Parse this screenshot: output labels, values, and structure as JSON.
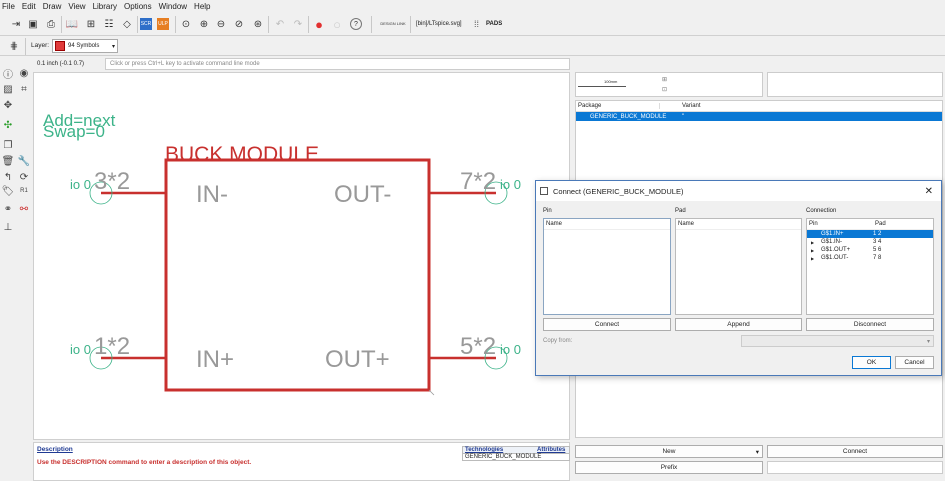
{
  "menu": [
    "File",
    "Edit",
    "Draw",
    "View",
    "Library",
    "Options",
    "Window",
    "Help"
  ],
  "toolbar": {
    "path_label": "[bin]/LTspice.svg]",
    "pads_label": "PADS",
    "design_link": "DESIGN LINK",
    "scr_label": "SCR",
    "ulp_label": "ULP"
  },
  "layer_bar": {
    "label": "Layer:",
    "selected": "94 Symbols"
  },
  "coord": {
    "readout": "0.1 inch (-0.1 0.7)",
    "command_placeholder": "Click or press Ctrl+L key to activate command line mode"
  },
  "schematic": {
    "add_text": "Add=next",
    "swap_text": "Swap=0",
    "title": "BUCK MODULE",
    "pins": [
      {
        "name": "IN-",
        "pad": "3*2",
        "io": "io 0"
      },
      {
        "name": "OUT-",
        "pad": "7*2",
        "io": "io 0"
      },
      {
        "name": "IN+",
        "pad": "1*2",
        "io": "io 0"
      },
      {
        "name": "OUT+",
        "pad": "5*2",
        "io": "io 0"
      }
    ]
  },
  "description": {
    "heading": "Description",
    "text": "Use the DESCRIPTION command to enter a description of this object.",
    "tech_headers": [
      "Technologies",
      "Attributes"
    ],
    "tech_row": "GENERIC_BUCK_MODULE"
  },
  "right_panel": {
    "preview_label": "100mm",
    "columns": [
      "Package",
      "Variant"
    ],
    "package_row": "GENERIC_BUCK_MODULE",
    "variant_row": "''",
    "new_label": "New",
    "connect_label": "Connect",
    "prefix_label": "Prefix"
  },
  "dialog": {
    "title": "Connect  (GENERIC_BUCK_MODULE)",
    "pin_section": "Pin",
    "pad_section": "Pad",
    "connection_section": "Connection",
    "pin_col": "Name",
    "pad_col": "Name",
    "conn_cols": [
      "Pin",
      "Pad"
    ],
    "connections": [
      {
        "pin": "G$1.IN+",
        "pad": "1 2",
        "selected": true
      },
      {
        "pin": "G$1.IN-",
        "pad": "3 4",
        "selected": false
      },
      {
        "pin": "G$1.OUT+",
        "pad": "5 6",
        "selected": false
      },
      {
        "pin": "G$1.OUT-",
        "pad": "7 8",
        "selected": false
      }
    ],
    "connect_btn": "Connect",
    "append_btn": "Append",
    "disconnect_btn": "Disconnect",
    "copy_from_label": "Copy from:",
    "ok_btn": "OK",
    "cancel_btn": "Cancel"
  },
  "colors": {
    "symbol": "#c8302e",
    "pin_text": "#999999",
    "name_text": "#3cb389",
    "selection": "#0a78d4"
  }
}
